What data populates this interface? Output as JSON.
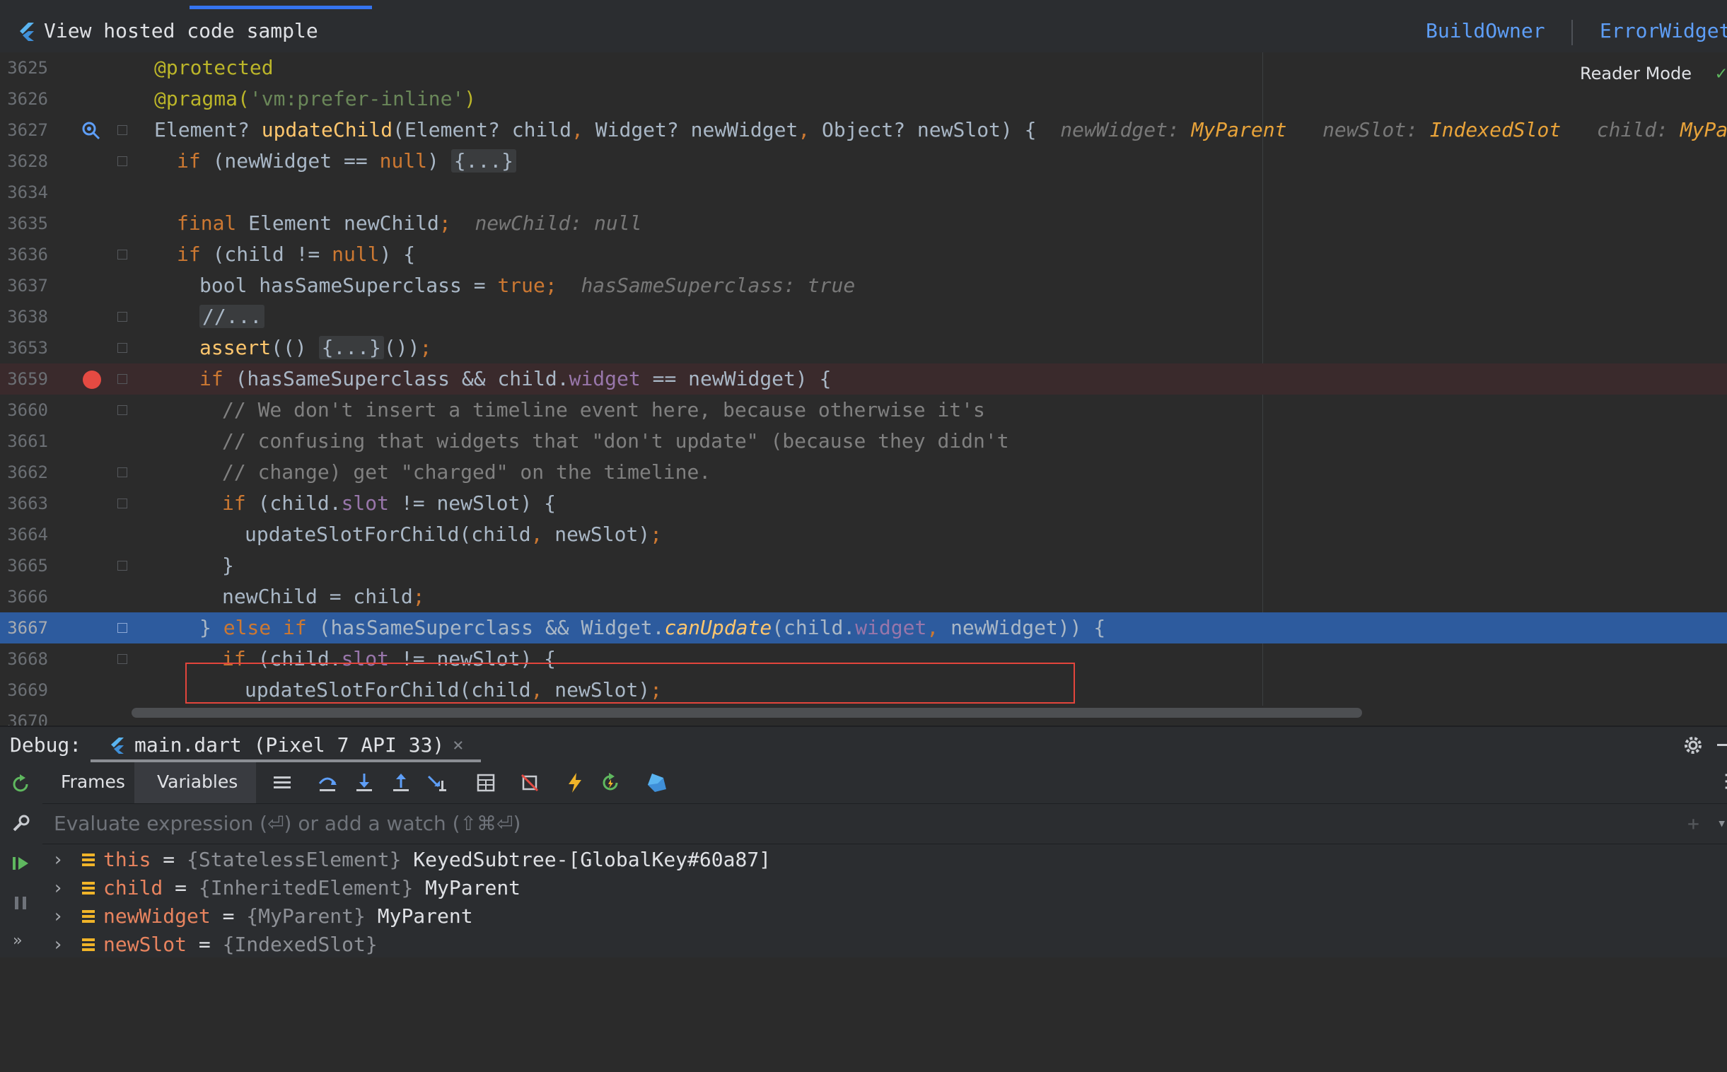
{
  "banner": {
    "title": "View hosted code sample",
    "links": [
      "BuildOwner",
      "ErrorWidget"
    ]
  },
  "editor": {
    "reader_mode": "Reader Mode",
    "lines": [
      {
        "num": "3625"
      },
      {
        "num": "3626"
      },
      {
        "num": "3627"
      },
      {
        "num": "3628"
      },
      {
        "num": "3634"
      },
      {
        "num": "3635"
      },
      {
        "num": "3636"
      },
      {
        "num": "3637"
      },
      {
        "num": "3638"
      },
      {
        "num": "3653"
      },
      {
        "num": "3659"
      },
      {
        "num": "3660"
      },
      {
        "num": "3661"
      },
      {
        "num": "3662"
      },
      {
        "num": "3663"
      },
      {
        "num": "3664"
      },
      {
        "num": "3665"
      },
      {
        "num": "3666"
      },
      {
        "num": "3667"
      },
      {
        "num": "3668"
      },
      {
        "num": "3669"
      },
      {
        "num": "3670"
      }
    ],
    "code": {
      "l3625": "@protected",
      "l3626_a": "@pragma(",
      "l3626_b": "'vm:prefer-inline'",
      "l3626_c": ")",
      "l3627_a": "Element? ",
      "l3627_fn": "updateChild",
      "l3627_b": "(Element? child",
      "l3627_c": ",",
      "l3627_d": " Widget? newWidget",
      "l3627_e": ",",
      "l3627_f": " Object? newSlot) {",
      "l3627_hints": [
        {
          "name": "newWidget:",
          "value": "MyParent"
        },
        {
          "name": "newSlot:",
          "value": "IndexedSlot"
        },
        {
          "name": "child:",
          "value": "MyParent"
        }
      ],
      "l3628_kw": "if",
      "l3628_a": " (newWidget == ",
      "l3628_null": "null",
      "l3628_b": ") ",
      "l3628_fold": "{...}",
      "l3635_kw": "final",
      "l3635_a": " Element newChild",
      "l3635_semi": ";",
      "l3635_hint": "newChild: null",
      "l3636_kw": "if",
      "l3636_a": " (child != ",
      "l3636_null": "null",
      "l3636_b": ") {",
      "l3637_a": "bool hasSameSuperclass = ",
      "l3637_true": "true",
      "l3637_semi": ";",
      "l3637_hint": "hasSameSuperclass: true",
      "l3638_fold": "//...",
      "l3653_fn": "assert",
      "l3653_a": "(() ",
      "l3653_fold": "{...}",
      "l3653_b": "())",
      "l3653_semi": ";",
      "l3659_kw": "if",
      "l3659_a": " (hasSameSuperclass && child.",
      "l3659_fld": "widget",
      "l3659_b": " == newWidget) {",
      "l3660": "// We don't insert a timeline event here, because otherwise it's",
      "l3661": "// confusing that widgets that \"don't update\" (because they didn't",
      "l3662": "// change) get \"charged\" on the timeline.",
      "l3663_kw": "if",
      "l3663_a": " (child.",
      "l3663_fld": "slot",
      "l3663_b": " != newSlot) {",
      "l3664_a": "updateSlotForChild(child",
      "l3664_c": ",",
      "l3664_b": " newSlot)",
      "l3664_semi": ";",
      "l3665": "}",
      "l3666_a": "newChild = child",
      "l3666_semi": ";",
      "l3667_a": "} ",
      "l3667_kw": "else if",
      "l3667_b": " (hasSameSuperclass && Widget.",
      "l3667_fn": "canUpdate",
      "l3667_c": "(child.",
      "l3667_fld": "widget",
      "l3667_comma": ",",
      "l3667_d": " newWidget)) {",
      "l3668_kw": "if",
      "l3668_a": " (child.",
      "l3668_fld": "slot",
      "l3668_b": " != newSlot) {",
      "l3669_a": "updateSlotForChild(child",
      "l3669_c": ",",
      "l3669_b": " newSlot)",
      "l3669_semi": ";"
    }
  },
  "debug": {
    "label": "Debug:",
    "session_tab": "main.dart (Pixel 7 API 33)",
    "tabs": [
      "Frames",
      "Variables"
    ],
    "eval_placeholder": "Evaluate expression (⏎) or add a watch (⇧⌘⏎)",
    "variables": [
      {
        "name": "this",
        "eq": " = ",
        "type": "{StatelessElement}",
        "value": " KeyedSubtree-[GlobalKey#60a87]"
      },
      {
        "name": "child",
        "eq": " = ",
        "type": "{InheritedElement}",
        "value": " MyParent"
      },
      {
        "name": "newWidget",
        "eq": " = ",
        "type": "{MyParent}",
        "value": " MyParent"
      },
      {
        "name": "newSlot",
        "eq": " = ",
        "type": "{IndexedSlot}",
        "value": ""
      }
    ]
  },
  "colors": {
    "exec_line": "#2d5b9e",
    "breakpoint": "#e44a42",
    "highlight_box": "#e2453c"
  }
}
